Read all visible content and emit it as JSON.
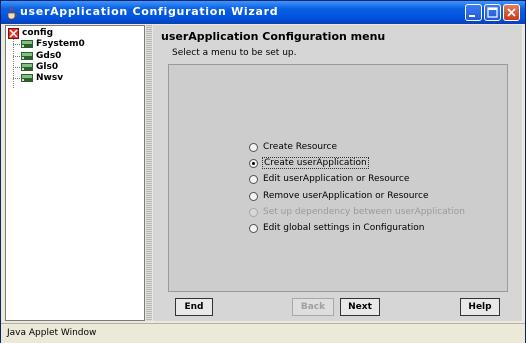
{
  "window": {
    "title": "userApplication Configuration Wizard"
  },
  "tree": {
    "root_label": "config",
    "children": [
      {
        "label": "Fsystem0"
      },
      {
        "label": "Gds0"
      },
      {
        "label": "Gls0"
      },
      {
        "label": "Nwsv"
      }
    ]
  },
  "content": {
    "title": "userApplication Configuration menu",
    "subtitle": "Select a menu to be set up.",
    "options": [
      {
        "label": "Create Resource",
        "checked": false,
        "disabled": false
      },
      {
        "label": "Create userApplication",
        "checked": true,
        "disabled": false
      },
      {
        "label": "Edit userApplication or Resource",
        "checked": false,
        "disabled": false
      },
      {
        "label": "Remove userApplication or Resource",
        "checked": false,
        "disabled": false
      },
      {
        "label": "Set up dependency between userApplication",
        "checked": false,
        "disabled": true
      },
      {
        "label": "Edit global settings in Configuration",
        "checked": false,
        "disabled": false
      }
    ]
  },
  "buttons": {
    "end_label": "End",
    "back_label": "Back",
    "next_label": "Next",
    "help_label": "Help"
  },
  "status": {
    "text": "Java Applet Window"
  },
  "colors": {
    "titlebar": "#0054e3",
    "content_bg": "#d6d6d6",
    "menu_box_bg": "#cdcdcd"
  }
}
